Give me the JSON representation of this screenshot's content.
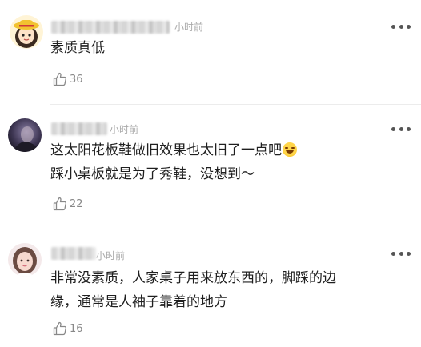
{
  "comments": [
    {
      "time": "小时前",
      "lines": [
        "素质真低"
      ],
      "likes": "36",
      "avatar_icon": "cartoon-girl-avatar"
    },
    {
      "time": "小时前",
      "lines": [
        "这太阳花板鞋做旧效果也太旧了一点吧",
        "踩小桌板就是为了秀鞋，没想到～"
      ],
      "likes": "22",
      "emoji": "grinning-sweat-emoji",
      "avatar_icon": "dark-photo-avatar"
    },
    {
      "time": "小时前",
      "lines": [
        "非常没素质，人家桌子用来放东西的，脚踩的边",
        "缘，通常是人袖子靠着的地方"
      ],
      "likes": "16",
      "avatar_icon": "girl-photo-avatar"
    }
  ],
  "colors": {
    "text": "#1f1f1f",
    "muted": "#aaaaaa",
    "like": "#888888",
    "divider": "#ececec"
  }
}
